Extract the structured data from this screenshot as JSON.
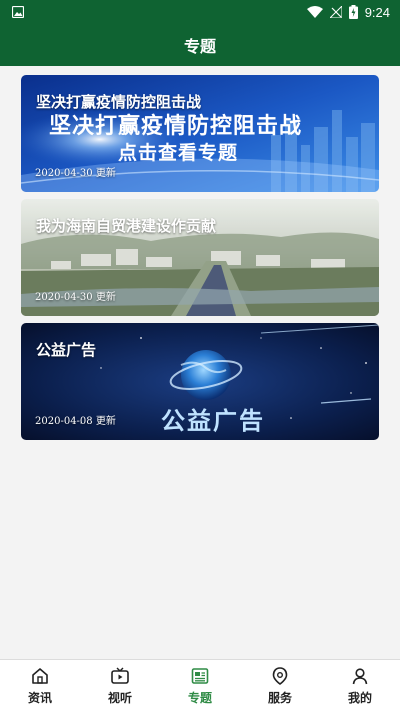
{
  "status_bar": {
    "time": "9:24"
  },
  "header": {
    "title": "专题"
  },
  "cards": [
    {
      "title": "坚决打赢疫情防控阻击战",
      "banner_line1": "坚决打赢疫情防控阻击战",
      "banner_line2": "点击查看专题",
      "date": "2020-04-30 更新"
    },
    {
      "title": "我为海南自贸港建设作贡献",
      "date": "2020-04-30 更新"
    },
    {
      "title": "公益广告",
      "banner_text": "公益广告",
      "date": "2020-04-08 更新"
    }
  ],
  "tabs": [
    {
      "label": "资讯",
      "icon": "home-icon"
    },
    {
      "label": "视听",
      "icon": "tv-icon"
    },
    {
      "label": "专题",
      "icon": "topic-icon",
      "active": true
    },
    {
      "label": "服务",
      "icon": "service-icon"
    },
    {
      "label": "我的",
      "icon": "user-icon"
    }
  ],
  "colors": {
    "primary": "#0f6332",
    "active_tab": "#2f8b45"
  }
}
